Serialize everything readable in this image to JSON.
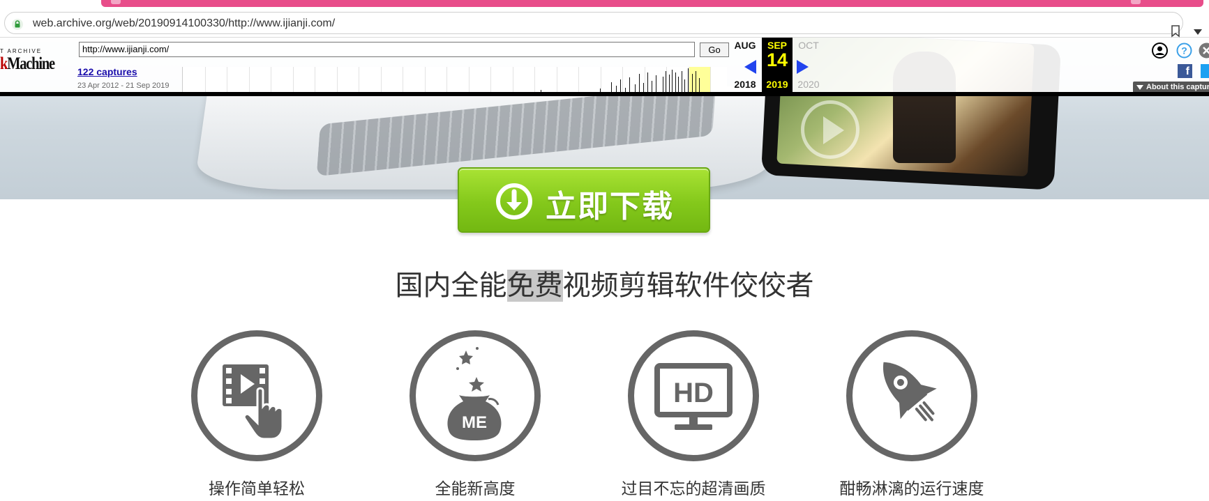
{
  "browser": {
    "url": "web.archive.org/web/20190914100330/http://www.ijianji.com/"
  },
  "wayback": {
    "logo_top": "T ARCHIVE",
    "logo_main_k": "k",
    "logo_main": "Machine",
    "url_input": "http://www.ijianji.com/",
    "go_label": "Go",
    "captures_label": "122 captures",
    "date_range": "23 Apr 2012 - 21 Sep 2019",
    "prev_month": "AUG",
    "prev_year": "2018",
    "current_month": "SEP",
    "current_day": "14",
    "current_year": "2019",
    "next_month": "OCT",
    "next_year": "2020",
    "about_label": "About this capture",
    "facebook_label": "f",
    "colors": {
      "current_bg": "#000000",
      "current_text": "#ffff00",
      "arrow": "#2244ee",
      "captures_link": "#1a0dab"
    }
  },
  "hero": {
    "download_label": "立即下载",
    "download_color": "#84c81b"
  },
  "headline": {
    "before": "国内全能",
    "highlight": "免费",
    "after": "视频剪辑软件佼佼者"
  },
  "features": [
    {
      "icon": "video-touch-icon",
      "label": "操作简单轻松"
    },
    {
      "icon": "money-bag-icon",
      "label": "全能新高度",
      "bag_text": "ME"
    },
    {
      "icon": "hd-monitor-icon",
      "label": "过目不忘的超清画质",
      "screen_text": "HD"
    },
    {
      "icon": "rocket-icon",
      "label": "酣畅淋漓的运行速度"
    }
  ]
}
